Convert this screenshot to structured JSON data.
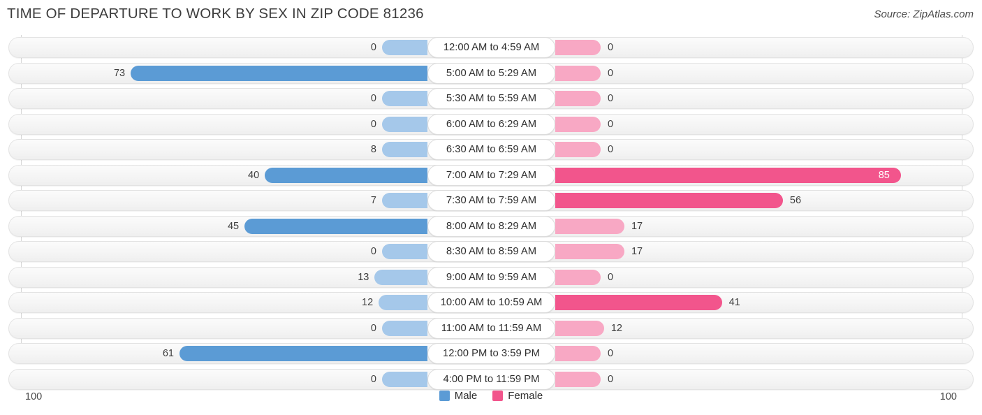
{
  "header": {
    "title": "TIME OF DEPARTURE TO WORK BY SEX IN ZIP CODE 81236",
    "source": "Source: ZipAtlas.com"
  },
  "axis": {
    "left_max_label": "100",
    "right_max_label": "100"
  },
  "legend": {
    "items": [
      {
        "label": "Male",
        "color": "#5b9bd5"
      },
      {
        "label": "Female",
        "color": "#f2558c"
      }
    ]
  },
  "colors": {
    "male_light": "#a5c8ea",
    "male_dark": "#5b9bd5",
    "female_light": "#f8a8c4",
    "female_dark": "#f2558c",
    "track": "#f5f5f5",
    "gridline": "#d6d6d6"
  },
  "chart_data": {
    "type": "bar",
    "subtype": "diverging-butterfly",
    "title": "TIME OF DEPARTURE TO WORK BY SEX IN ZIP CODE 81236",
    "xlabel": "",
    "ylabel": "",
    "xlim": [
      0,
      100
    ],
    "grid": true,
    "legend_position": "bottom-center",
    "categories": [
      "12:00 AM to 4:59 AM",
      "5:00 AM to 5:29 AM",
      "5:30 AM to 5:59 AM",
      "6:00 AM to 6:29 AM",
      "6:30 AM to 6:59 AM",
      "7:00 AM to 7:29 AM",
      "7:30 AM to 7:59 AM",
      "8:00 AM to 8:29 AM",
      "8:30 AM to 8:59 AM",
      "9:00 AM to 9:59 AM",
      "10:00 AM to 10:59 AM",
      "11:00 AM to 11:59 AM",
      "12:00 PM to 3:59 PM",
      "4:00 PM to 11:59 PM"
    ],
    "series": [
      {
        "name": "Male",
        "side": "left",
        "values": [
          0,
          73,
          0,
          0,
          8,
          40,
          7,
          45,
          0,
          13,
          12,
          0,
          61,
          0
        ]
      },
      {
        "name": "Female",
        "side": "right",
        "values": [
          0,
          0,
          0,
          0,
          0,
          85,
          56,
          17,
          17,
          0,
          41,
          12,
          0,
          0
        ]
      }
    ]
  }
}
